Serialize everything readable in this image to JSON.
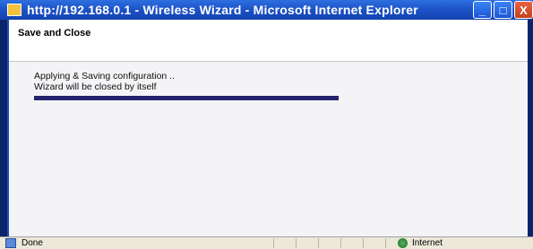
{
  "window": {
    "title": "http://192.168.0.1 - Wireless Wizard - Microsoft Internet Explorer",
    "buttons": {
      "minimize": "_",
      "maximize": "□",
      "close": "X"
    }
  },
  "dialog": {
    "header_title": "Save and Close",
    "message_line1": "Applying & Saving configuration ..",
    "message_line2": "Wizard will be closed by itself",
    "progress_percent": 100
  },
  "statusbar": {
    "status_text": "Done",
    "zone_text": "Internet"
  },
  "colors": {
    "progress": "#23236e",
    "titlebar": "#1a4fc4"
  }
}
